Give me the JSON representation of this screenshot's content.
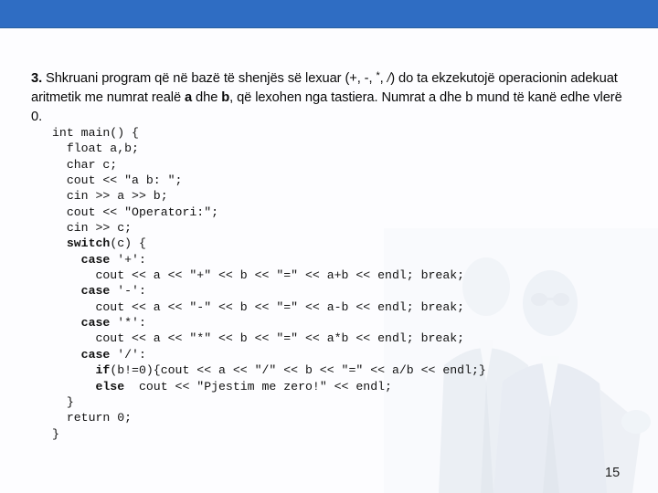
{
  "slide": {
    "banner_color": "#2f6dc3",
    "background_color": "#fdfdff",
    "page_number": "15"
  },
  "task": {
    "number": "3.",
    "line1_a": " Shkruani program që në bazë të shenjës së lexuar (+, -, ",
    "line1_star": "*",
    "line1_b": ", ",
    "line1_slash": "/",
    "line1_c": ") do ta ekzekutojë operacionin adekuat aritmetik me numrat realë ",
    "bold_a": "a",
    "mid_1": " dhe ",
    "bold_b": "b",
    "line2_tail": ", që lexohen nga tastiera. Numrat a dhe b mund të kanë edhe vlerë 0."
  },
  "code": {
    "language": "cpp",
    "lines": [
      {
        "indent": "",
        "segments": [
          {
            "t": "int main() {",
            "bold": false
          }
        ]
      },
      {
        "indent": "",
        "segments": [
          {
            "t": "  float a,b;",
            "bold": false
          }
        ]
      },
      {
        "indent": "",
        "segments": [
          {
            "t": "  char c;",
            "bold": false
          }
        ]
      },
      {
        "indent": "",
        "segments": [
          {
            "t": "  cout << \"a b: \";",
            "bold": false
          }
        ]
      },
      {
        "indent": "",
        "segments": [
          {
            "t": "  cin >> a >> b;",
            "bold": false
          }
        ]
      },
      {
        "indent": "",
        "segments": [
          {
            "t": "  cout << \"Operatori:\";",
            "bold": false
          }
        ]
      },
      {
        "indent": "",
        "segments": [
          {
            "t": "  cin >> c;",
            "bold": false
          }
        ]
      },
      {
        "indent": "",
        "segments": [
          {
            "t": "  ",
            "bold": false
          },
          {
            "t": "switch",
            "bold": true
          },
          {
            "t": "(c) {",
            "bold": false
          }
        ]
      },
      {
        "indent": "",
        "segments": [
          {
            "t": "    ",
            "bold": false
          },
          {
            "t": "case",
            "bold": true
          },
          {
            "t": " '+':",
            "bold": false
          }
        ]
      },
      {
        "indent": "",
        "segments": [
          {
            "t": "      cout << a << \"+\" << b << \"=\" << a+b << endl; break;",
            "bold": false
          }
        ]
      },
      {
        "indent": "",
        "segments": [
          {
            "t": "    ",
            "bold": false
          },
          {
            "t": "case",
            "bold": true
          },
          {
            "t": " '-':",
            "bold": false
          }
        ]
      },
      {
        "indent": "",
        "segments": [
          {
            "t": "      cout << a << \"-\" << b << \"=\" << a-b << endl; break;",
            "bold": false
          }
        ]
      },
      {
        "indent": "",
        "segments": [
          {
            "t": "    ",
            "bold": false
          },
          {
            "t": "case",
            "bold": true
          },
          {
            "t": " '*':",
            "bold": false
          }
        ]
      },
      {
        "indent": "",
        "segments": [
          {
            "t": "      cout << a << \"*\" << b << \"=\" << a*b << endl; break;",
            "bold": false
          }
        ]
      },
      {
        "indent": "",
        "segments": [
          {
            "t": "    ",
            "bold": false
          },
          {
            "t": "case",
            "bold": true
          },
          {
            "t": " '/':",
            "bold": false
          }
        ]
      },
      {
        "indent": "",
        "segments": [
          {
            "t": "      ",
            "bold": false
          },
          {
            "t": "if",
            "bold": true
          },
          {
            "t": "(b!=0){cout << a << \"/\" << b << \"=\" << a/b << endl;}",
            "bold": false
          }
        ]
      },
      {
        "indent": "",
        "segments": [
          {
            "t": "      ",
            "bold": false
          },
          {
            "t": "else",
            "bold": true
          },
          {
            "t": "  cout << \"Pjestim me zero!\" << endl;",
            "bold": false
          }
        ]
      },
      {
        "indent": "",
        "segments": [
          {
            "t": "  }",
            "bold": false
          }
        ]
      },
      {
        "indent": "",
        "segments": [
          {
            "t": "  return 0;",
            "bold": false
          }
        ]
      },
      {
        "indent": "",
        "segments": [
          {
            "t": "}",
            "bold": false
          }
        ]
      }
    ]
  }
}
